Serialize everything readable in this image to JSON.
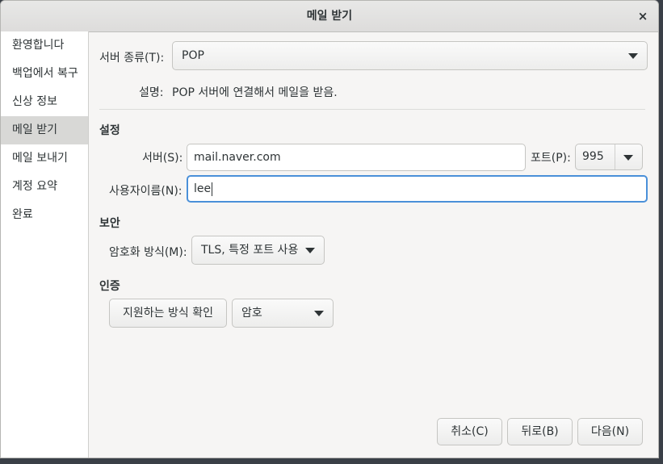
{
  "window": {
    "title": "메일 받기",
    "close_glyph": "×"
  },
  "sidebar": {
    "items": [
      {
        "label": "환영합니다",
        "active": false
      },
      {
        "label": "백업에서 복구",
        "active": false
      },
      {
        "label": "신상 정보",
        "active": false
      },
      {
        "label": "메일 받기",
        "active": true
      },
      {
        "label": "메일 보내기",
        "active": false
      },
      {
        "label": "계정 요약",
        "active": false
      },
      {
        "label": "완료",
        "active": false
      }
    ]
  },
  "server_type": {
    "label": "서버 종류(T):",
    "value": "POP",
    "description_label": "설명:",
    "description": "POP 서버에 연결해서 메일을 받음."
  },
  "settings": {
    "heading": "설정",
    "server_label": "서버(S):",
    "server_value": "mail.naver.com",
    "port_label": "포트(P):",
    "port_value": "995",
    "username_label": "사용자이름(N):",
    "username_value": "lee"
  },
  "security": {
    "heading": "보안",
    "encryption_label": "암호화 방식(M):",
    "encryption_value": "TLS, 특정 포트 사용"
  },
  "auth": {
    "heading": "인증",
    "check_button": "지원하는 방식 확인",
    "method_value": "암호"
  },
  "footer": {
    "cancel": "취소(C)",
    "back": "뒤로(B)",
    "next": "다음(N)"
  },
  "icons": {
    "dropdown": "chevron-down-icon",
    "close": "close-icon"
  },
  "colors": {
    "focus": "#4a90d9",
    "sidebar_active": "#d8d8d6"
  }
}
